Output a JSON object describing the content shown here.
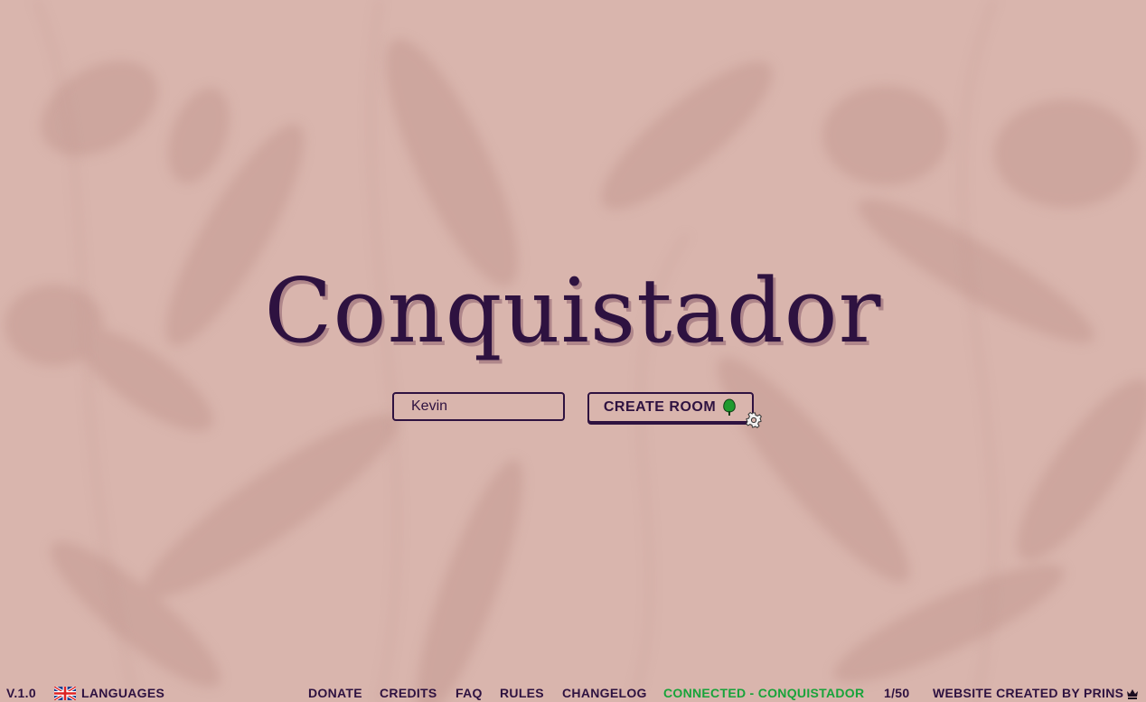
{
  "app": {
    "title": "Conquistador"
  },
  "form": {
    "name_value": "Kevin",
    "create_room_label": "CREATE ROOM"
  },
  "footer": {
    "version": "V.1.0",
    "languages_label": "LANGUAGES",
    "donate_label": "DONATE",
    "credits_label": "CREDITS",
    "faq_label": "FAQ",
    "rules_label": "RULES",
    "changelog_label": "CHANGELOG",
    "status_label": "CONNECTED - CONQUISTADOR",
    "player_count": "1/50",
    "created_by_label": "WEBSITE CREATED BY PRINS"
  },
  "colors": {
    "background": "#d9b5ad",
    "ink": "#2e1240",
    "connected": "#18a33a",
    "tree": "#1f9a2e"
  },
  "icons": {
    "language_flag": "uk-flag-icon",
    "room_button": "tree-icon",
    "settings": "gear-icon",
    "creator": "crown-icon"
  }
}
